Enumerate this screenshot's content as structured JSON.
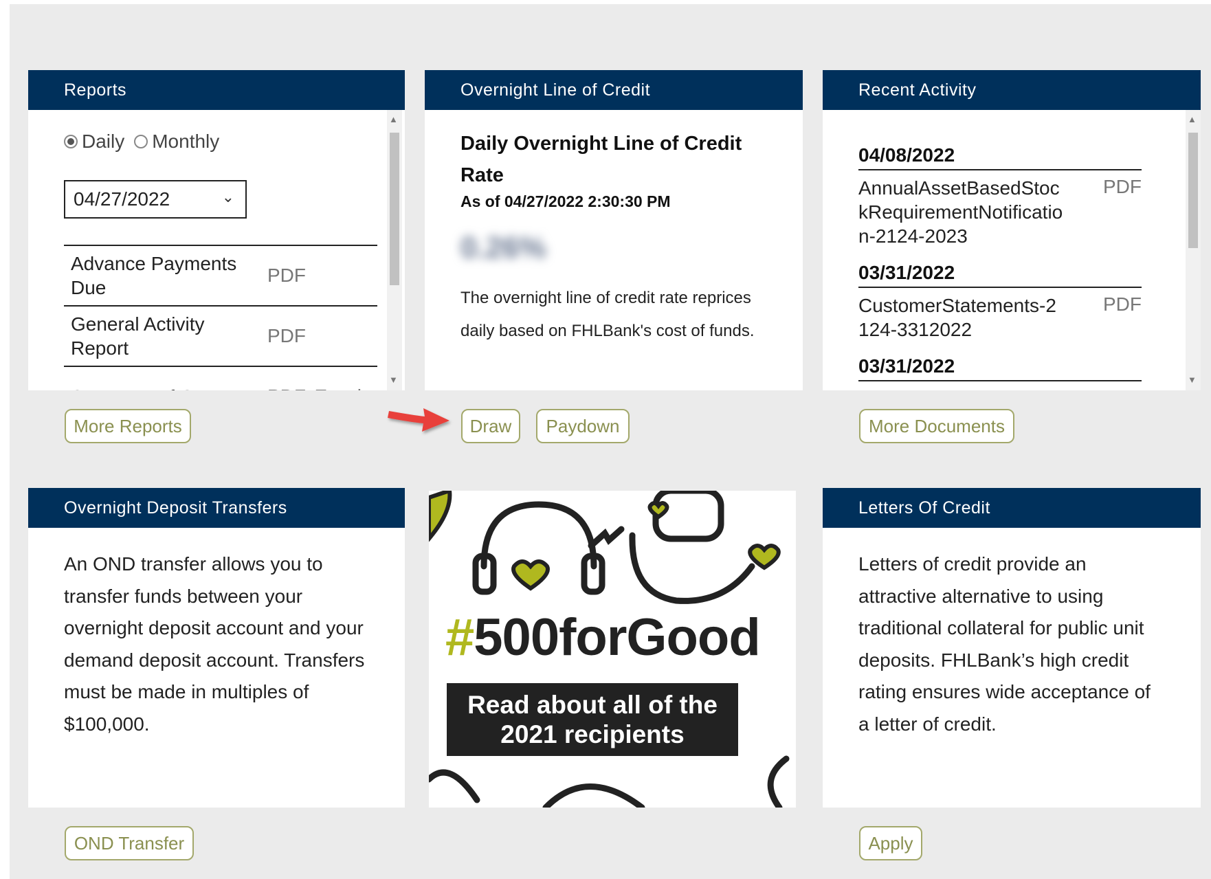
{
  "reports": {
    "title": "Reports",
    "radio_daily": "Daily",
    "radio_monthly": "Monthly",
    "selected_period": "Daily",
    "date_value": "04/27/2022",
    "rows": [
      {
        "name": "Advance Payments Due",
        "type": "PDF"
      },
      {
        "name": "General Activity Report",
        "type": "PDF"
      },
      {
        "name": "Summary of Current",
        "type": "PDF, Excel"
      }
    ],
    "more_button": "More Reports"
  },
  "olc": {
    "title": "Overnight Line of Credit",
    "heading": "Daily Overnight Line of Credit Rate",
    "as_of": "As of 04/27/2022 2:30:30 PM",
    "rate": "0.26%",
    "description": "The overnight line of credit rate reprices daily based on FHLBank's cost of funds.",
    "draw_button": "Draw",
    "paydown_button": "Paydown"
  },
  "activity": {
    "title": "Recent Activity",
    "groups": [
      {
        "date": "04/08/2022",
        "name": "AnnualAssetBasedStockRequirementNotification-2124-2023",
        "type": "PDF"
      },
      {
        "date": "03/31/2022",
        "name": "CustomerStatements-2124-3312022",
        "type": "PDF"
      },
      {
        "date": "03/31/2022",
        "name": "",
        "type": ""
      }
    ],
    "more_button": "More Documents"
  },
  "ond": {
    "title": "Overnight Deposit Transfers",
    "description": "An OND transfer allows you to transfer funds between your overnight deposit account and your demand deposit account. Transfers must be made in multiples of $100,000.",
    "button": "OND Transfer"
  },
  "promo": {
    "hashtag_symbol": "#",
    "hashtag_text": "500forGood",
    "line1": "Read about all of the",
    "line2": "2021 recipients"
  },
  "loc": {
    "title": "Letters Of Credit",
    "description": "Letters of credit provide an attractive alternative to using traditional collateral for public unit deposits. FHLBank’s high credit rating ensures wide acceptance of a letter of credit.",
    "button": "Apply"
  },
  "colors": {
    "header_bg": "#00305b",
    "button_border": "#a3a86b",
    "button_text": "#8a9050",
    "page_bg": "#ebebeb",
    "arrow": "#e8403a",
    "promo_accent": "#b0b81f"
  }
}
